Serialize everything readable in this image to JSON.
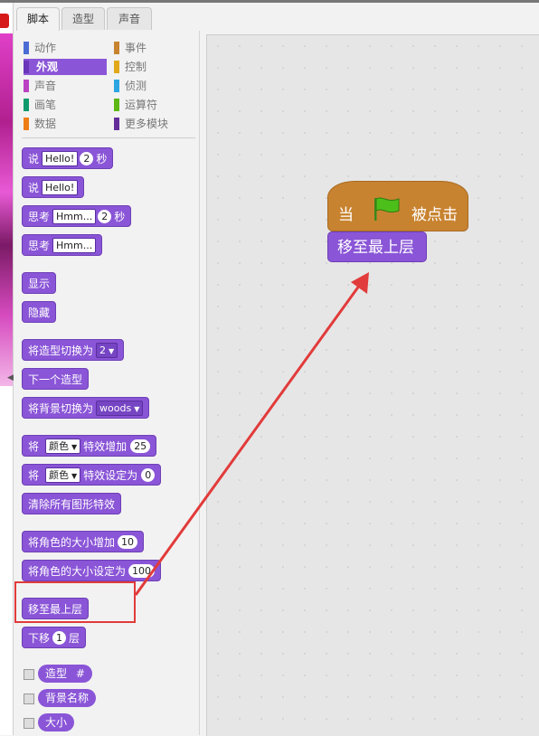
{
  "tabs": [
    "脚本",
    "造型",
    "声音"
  ],
  "categories": [
    {
      "label": "动作",
      "color": "#4a6cd4"
    },
    {
      "label": "事件",
      "color": "#c88330"
    },
    {
      "label": "外观",
      "color": "#8a55d7",
      "selected": true
    },
    {
      "label": "控制",
      "color": "#e1a91a"
    },
    {
      "label": "声音",
      "color": "#bb42c3"
    },
    {
      "label": "侦测",
      "color": "#2ca5e2"
    },
    {
      "label": "画笔",
      "color": "#0e9a6c"
    },
    {
      "label": "运算符",
      "color": "#5cb712"
    },
    {
      "label": "数据",
      "color": "#ee7d16"
    },
    {
      "label": "更多模块",
      "color": "#632d99"
    }
  ],
  "blocks": {
    "say_secs": {
      "text1": "说",
      "input": "Hello!",
      "num": "2",
      "text2": "秒"
    },
    "say": {
      "text1": "说",
      "input": "Hello!"
    },
    "think_secs": {
      "text1": "思考",
      "input": "Hmm...",
      "num": "2",
      "text2": "秒"
    },
    "think": {
      "text1": "思考",
      "input": "Hmm..."
    },
    "show": "显示",
    "hide": "隐藏",
    "switch_costume": {
      "text1": "将造型切换为",
      "value": "2"
    },
    "next_costume": "下一个造型",
    "switch_backdrop": {
      "text1": "将背景切换为",
      "value": "woods"
    },
    "change_effect": {
      "text1": "将",
      "effect": "颜色",
      "text2": "特效增加",
      "num": "25"
    },
    "set_effect": {
      "text1": "将",
      "effect": "颜色",
      "text2": "特效设定为",
      "num": "0"
    },
    "clear_effects": "清除所有图形特效",
    "change_size": {
      "text1": "将角色的大小增加",
      "num": "10"
    },
    "set_size": {
      "text1": "将角色的大小设定为",
      "num": "100"
    },
    "go_front": "移至最上层",
    "go_back": {
      "text1": "下移",
      "num": "1",
      "text2": "层"
    }
  },
  "reporters": {
    "costume": {
      "label": "造型",
      "suffix": "#"
    },
    "backdrop": {
      "label": "背景名称"
    },
    "size": {
      "label": "大小"
    }
  },
  "script": {
    "hat_when": "当",
    "hat_clicked": "被点击",
    "block": "移至最上层"
  },
  "colors": {
    "looks": "#8a55d7",
    "events": "#c88330",
    "highlight": "#e23b3b"
  }
}
